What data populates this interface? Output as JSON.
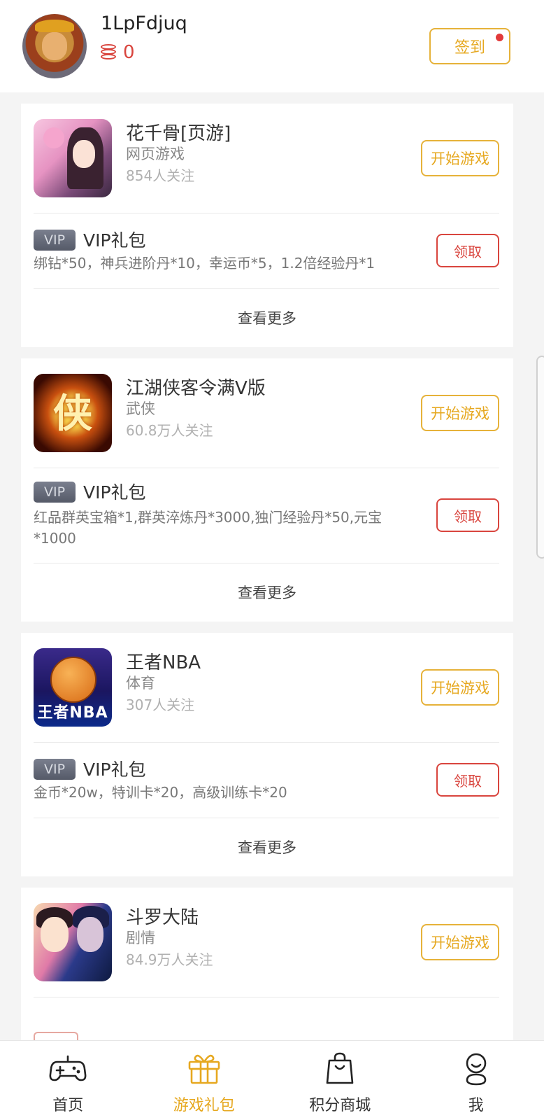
{
  "user": {
    "name": "1LpFdjuq",
    "coins": "0",
    "checkin_label": "签到"
  },
  "games": [
    {
      "name": "花千骨[页游]",
      "category": "网页游戏",
      "followers": "854人关注",
      "play_label": "开始游戏",
      "gift": {
        "badge": "VIP",
        "title": "VIP礼包",
        "desc": "绑钻*50，神兵进阶丹*10，幸运币*5，1.2倍经验丹*1",
        "claim_label": "领取"
      },
      "more_label": "查看更多",
      "icon": "huaqiangu-game-icon"
    },
    {
      "name": "江湖侠客令满V版",
      "category": "武侠",
      "followers": "60.8万人关注",
      "play_label": "开始游戏",
      "icon_text": "侠",
      "gift": {
        "badge": "VIP",
        "title": "VIP礼包",
        "desc": "红品群英宝箱*1,群英淬炼丹*3000,独门经验丹*50,元宝*1000",
        "claim_label": "领取"
      },
      "more_label": "查看更多",
      "icon": "jianghu-game-icon"
    },
    {
      "name": "王者NBA",
      "category": "体育",
      "followers": "307人关注",
      "play_label": "开始游戏",
      "icon_text": "王者NBA",
      "gift": {
        "badge": "VIP",
        "title": "VIP礼包",
        "desc": "金币*20w，特训卡*20，高级训练卡*20",
        "claim_label": "领取"
      },
      "more_label": "查看更多",
      "icon": "nba-game-icon"
    },
    {
      "name": "斗罗大陆",
      "category": "剧情",
      "followers": "84.9万人关注",
      "play_label": "开始游戏",
      "icon": "douluo-game-icon"
    }
  ],
  "tabs": [
    {
      "label": "首页",
      "icon": "gamepad-icon",
      "active": false
    },
    {
      "label": "游戏礼包",
      "icon": "gift-icon",
      "active": true
    },
    {
      "label": "积分商城",
      "icon": "shopping-bag-icon",
      "active": false
    },
    {
      "label": "我",
      "icon": "user-icon",
      "active": false
    }
  ],
  "colors": {
    "accent": "#e6a820",
    "claim": "#d9453e",
    "background": "#f4f4f4"
  }
}
